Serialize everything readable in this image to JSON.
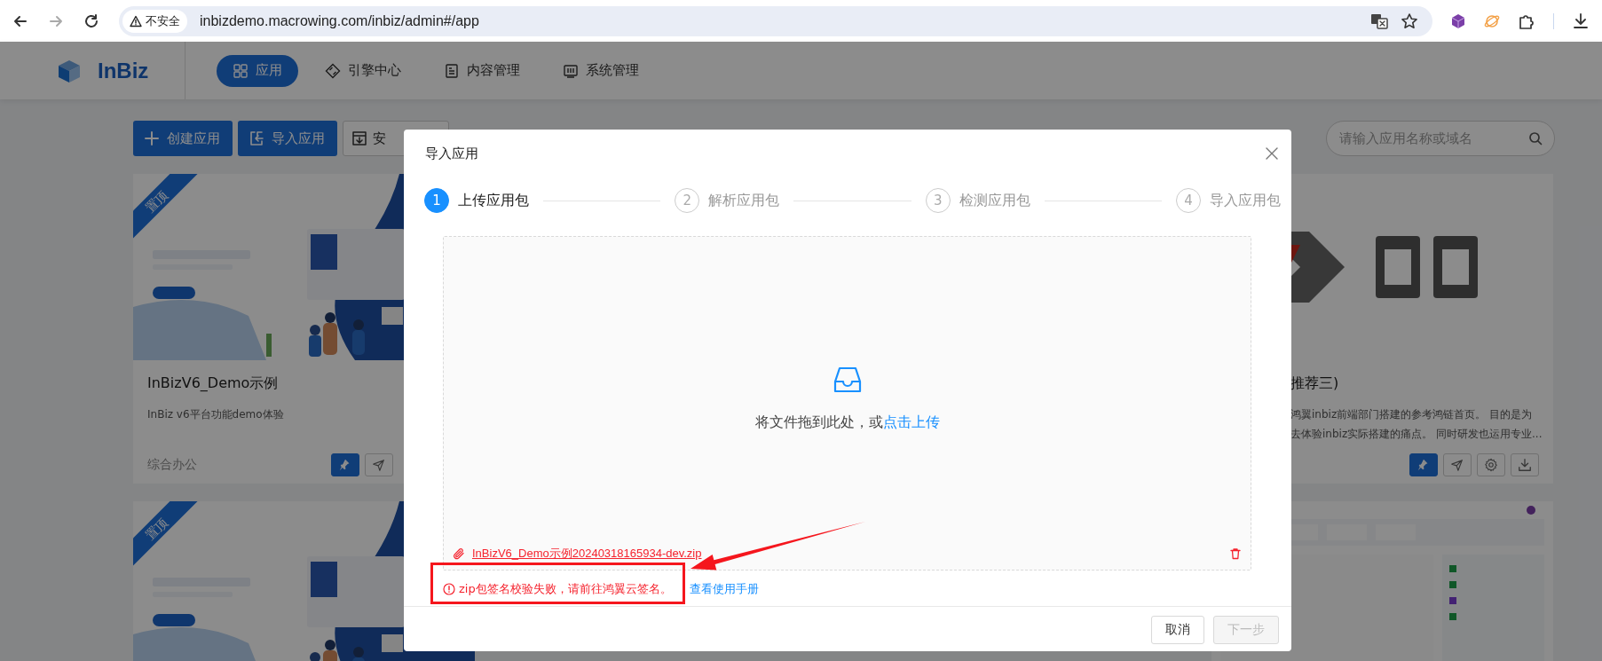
{
  "browser": {
    "back_disabled": false,
    "forward_disabled": true,
    "security_label": "不安全",
    "url": "inbizdemo.macrowing.com/inbiz/admin#/app"
  },
  "header": {
    "logo": "InBiz",
    "nav": [
      {
        "label": "应用",
        "selected": true
      },
      {
        "label": "引擎中心",
        "selected": false
      },
      {
        "label": "内容管理",
        "selected": false
      },
      {
        "label": "系统管理",
        "selected": false
      }
    ]
  },
  "toolbar": {
    "buttons": [
      {
        "label": "创建应用",
        "kind": "primary"
      },
      {
        "label": "导入应用",
        "kind": "primary"
      },
      {
        "label": "安",
        "kind": "default"
      }
    ],
    "search": {
      "placeholder": "请输入应用名称或域名"
    }
  },
  "cards": [
    {
      "ribbon": "置顶",
      "title": "InBizV6_Demo示例",
      "description_lines": [
        "InBiz v6平台功能demo体验"
      ],
      "category": "综合办公",
      "actions": [
        {
          "kind": "pin",
          "active": true
        },
        {
          "kind": "send",
          "active": false
        }
      ]
    },
    {
      "title": "推荐三)",
      "description_lines": [
        "鸿翼inbiz前端部门搭建的参考鸿链首页。 目的是为",
        "去体验inbiz实际搭建的痛点。 同时研发也运用专业..."
      ],
      "actions": [
        {
          "kind": "pin",
          "active": true
        },
        {
          "kind": "send",
          "active": false
        },
        {
          "kind": "settings",
          "active": false
        },
        {
          "kind": "download",
          "active": false
        }
      ]
    },
    {
      "ribbon": "置顶"
    }
  ],
  "dialog": {
    "title": "导入应用",
    "steps": [
      {
        "number": "1",
        "label": "上传应用包",
        "current": true
      },
      {
        "number": "2",
        "label": "解析应用包",
        "current": false
      },
      {
        "number": "3",
        "label": "检测应用包",
        "current": false
      },
      {
        "number": "4",
        "label": "导入应用包",
        "current": false
      }
    ],
    "upload": {
      "hint": "将文件拖到此处，或",
      "link": "点击上传",
      "file": {
        "name": "InBizV6_Demo示例20240318165934-dev.zip",
        "error": true
      }
    },
    "error": {
      "message": "zip包签名校验失败，请前往鸿翼云签名。",
      "link": "查看使用手册"
    },
    "buttons": [
      {
        "label": "取消",
        "disabled": false
      },
      {
        "label": "下一步",
        "disabled": true
      }
    ]
  },
  "annotations": {
    "highlight_box": true,
    "arrow": true
  }
}
